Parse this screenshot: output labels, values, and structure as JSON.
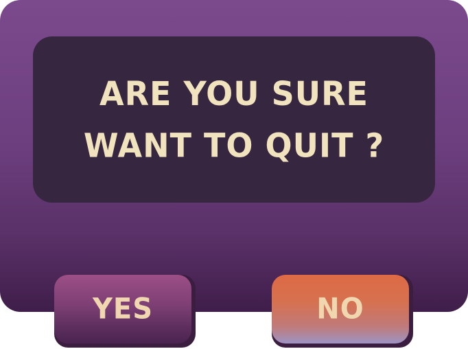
{
  "dialog": {
    "message_line1": "ARE YOU SURE",
    "message_line2": "WANT TO QUIT ?"
  },
  "buttons": {
    "yes_label": "YES",
    "no_label": "NO"
  },
  "colors": {
    "panel_purple": "#7b4a8d",
    "message_bg": "#372640",
    "text_cream": "#f1e3bd",
    "yes_button": "#9c4f86",
    "no_button": "#de6a45"
  }
}
